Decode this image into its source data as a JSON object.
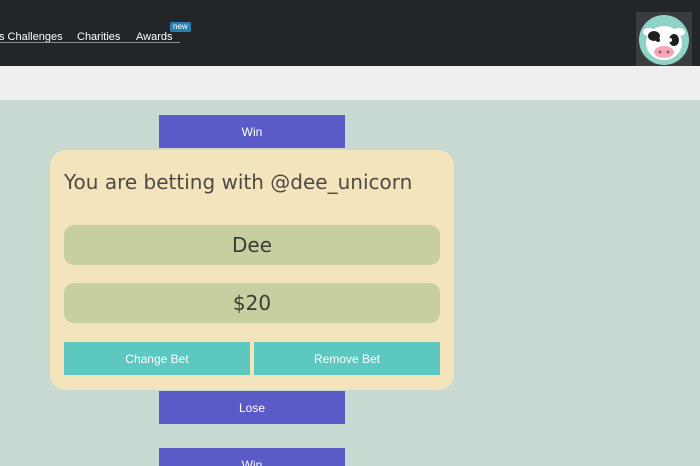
{
  "nav": {
    "items": [
      "s Challenges",
      "Charities",
      "Awards"
    ],
    "new_badge": "new"
  },
  "avatar": {
    "icon": "cow-avatar-icon"
  },
  "buttons": {
    "top": "Win",
    "lose": "Lose",
    "bottom": "Win"
  },
  "card": {
    "title": "You are betting with @dee_unicorn",
    "name": "Dee",
    "amount": "$20",
    "change_label": "Change Bet",
    "remove_label": "Remove Bet"
  },
  "colors": {
    "topbar": "#232629",
    "background": "#c8d9d2",
    "button_purple": "#5b5bc8",
    "card": "#f3e4bc",
    "pill": "#c7cfa1",
    "button_teal": "#5dc8c0"
  }
}
